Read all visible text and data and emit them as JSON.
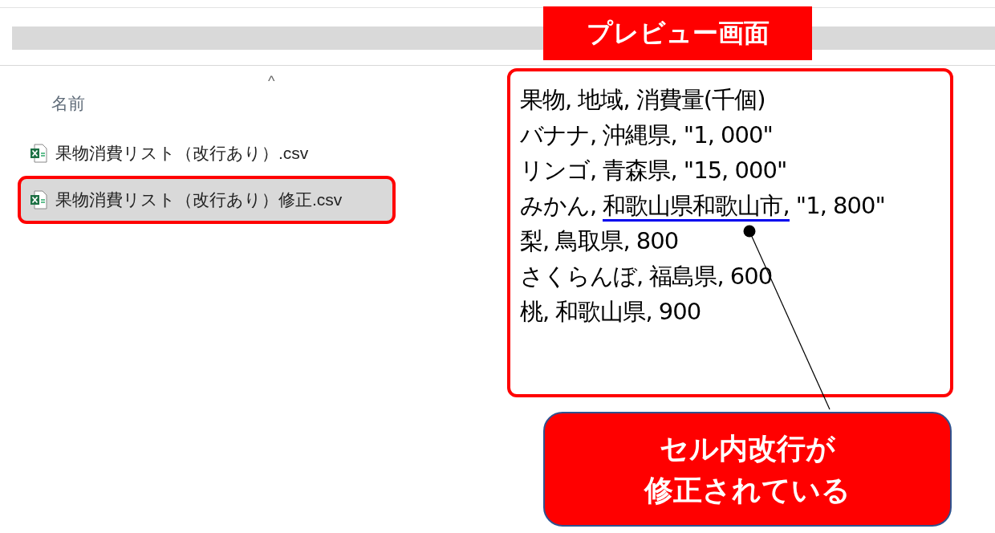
{
  "file_list": {
    "sort_indicator": "^",
    "column_header": "名前",
    "files": [
      {
        "name": "果物消費リスト（改行あり）.csv",
        "selected": false,
        "highlighted": false
      },
      {
        "name": "果物消費リスト（改行あり）修正.csv",
        "selected": true,
        "highlighted": true
      }
    ]
  },
  "preview": {
    "lines": [
      [
        {
          "text": "果物, 地域, 消費量(千個)",
          "underlined": false
        }
      ],
      [
        {
          "text": "バナナ, 沖縄県, \"1, 000\"",
          "underlined": false
        }
      ],
      [
        {
          "text": "リンゴ, 青森県, \"15, 000\"",
          "underlined": false
        }
      ],
      [
        {
          "text": "みかん, ",
          "underlined": false
        },
        {
          "text": "和歌山県和歌山市,",
          "underlined": true
        },
        {
          "text": " \"1, 800\"",
          "underlined": false
        }
      ],
      [
        {
          "text": "梨, 鳥取県, 800",
          "underlined": false
        }
      ],
      [
        {
          "text": "さくらんぼ, 福島県, 600",
          "underlined": false
        }
      ],
      [
        {
          "text": "桃, 和歌山県, 900",
          "underlined": false
        }
      ]
    ]
  },
  "annotations": {
    "title": "プレビュー画面",
    "callout": [
      "セル内改行が",
      "修正されている"
    ]
  }
}
